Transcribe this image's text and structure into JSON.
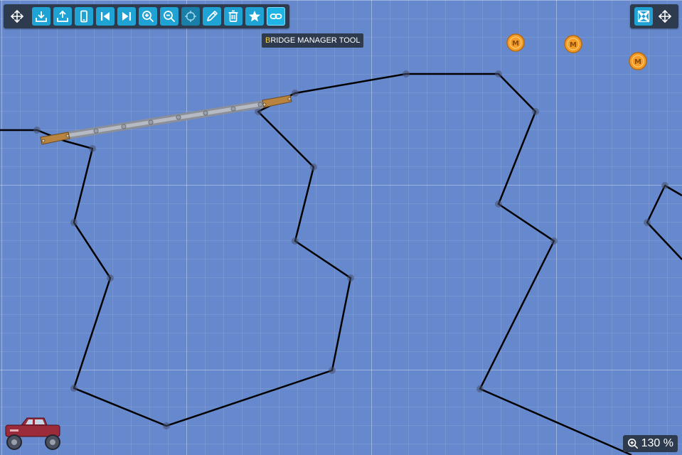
{
  "toolbar_left": {
    "buttons": [
      {
        "name": "move-tool-icon",
        "label": "Move"
      },
      {
        "name": "load-level-icon",
        "label": "Load"
      },
      {
        "name": "save-level-icon",
        "label": "Save"
      },
      {
        "name": "device-preview-icon",
        "label": "Device"
      },
      {
        "name": "skip-to-start-icon",
        "label": "Start"
      },
      {
        "name": "skip-to-end-icon",
        "label": "End"
      },
      {
        "name": "zoom-in-icon",
        "label": "Zoom in"
      },
      {
        "name": "zoom-out-icon",
        "label": "Zoom out"
      },
      {
        "name": "crosshair-icon",
        "label": "Target"
      },
      {
        "name": "pencil-icon",
        "label": "Draw"
      },
      {
        "name": "trash-icon",
        "label": "Delete"
      },
      {
        "name": "star-icon",
        "label": "Favorite"
      },
      {
        "name": "bridge-link-icon",
        "label": "Bridge manager"
      }
    ]
  },
  "toolbar_right": {
    "buttons": [
      {
        "name": "fit-view-icon"
      },
      {
        "name": "pan-icon"
      }
    ]
  },
  "tooltip": {
    "first_letter": "B",
    "rest": "RIDGE MANAGER TOOL"
  },
  "zoom": {
    "label": "130 %"
  },
  "coins": {
    "count": 3,
    "glyph": "M"
  },
  "colors": {
    "background": "#6688cc",
    "toolbar": "#2e3a4e",
    "button": "#1fa2d4",
    "terrain_line": "#000000",
    "coin": "#f39c28",
    "wood": "#b8843f",
    "truck": "#9b2a3a"
  }
}
